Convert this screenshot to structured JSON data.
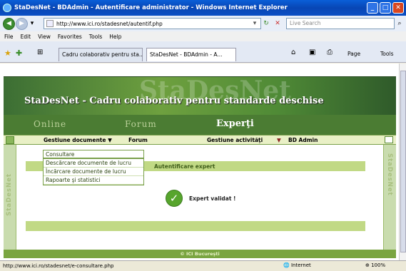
{
  "window": {
    "title": "StaDesNet - BDAdmin - Autentificare administrator - Windows Internet Explorer"
  },
  "nav": {
    "url": "http://www.ici.ro/stadesnet/autentif.php",
    "search_placeholder": "Live Search"
  },
  "menubar": [
    "File",
    "Edit",
    "View",
    "Favorites",
    "Tools",
    "Help"
  ],
  "tabs": [
    {
      "label": "Cadru colaborativ pentru sta...",
      "active": false
    },
    {
      "label": "StaDesNet - BDAdmin - A...",
      "active": true
    }
  ],
  "commandbar": {
    "page": "Page",
    "tools": "Tools"
  },
  "site": {
    "banner_ghost": "StaDesNet",
    "banner_title": "StaDesNet - Cadru colaborativ pentru standarde deschise",
    "band_online": "Online",
    "band_forum": "Forum",
    "band_experti": "Experţi",
    "menu": {
      "gestiune_documente": "Gestiune documente ▼",
      "forum": "Forum",
      "gestiune_activitati": "Gestiune activităţi",
      "arrow": "▼",
      "bd_admin": "BD Admin"
    },
    "dropdown_items": [
      "Consultare",
      "Descărcare documente de lucru",
      "Încărcare documente de lucru",
      "Rapoarte şi statistici"
    ],
    "side_text": "StaDesNet",
    "auth_title": "Autentificare expert",
    "validated": "Expert validat !",
    "footer": "© ICI Bucureşti"
  },
  "status": {
    "url": "http://www.ici.ro/stadesnet/e-consultare.php",
    "zone": "Internet",
    "zoom": "100%"
  },
  "colors": {
    "accent": "#4b7c33",
    "light_green": "#c1d985"
  }
}
